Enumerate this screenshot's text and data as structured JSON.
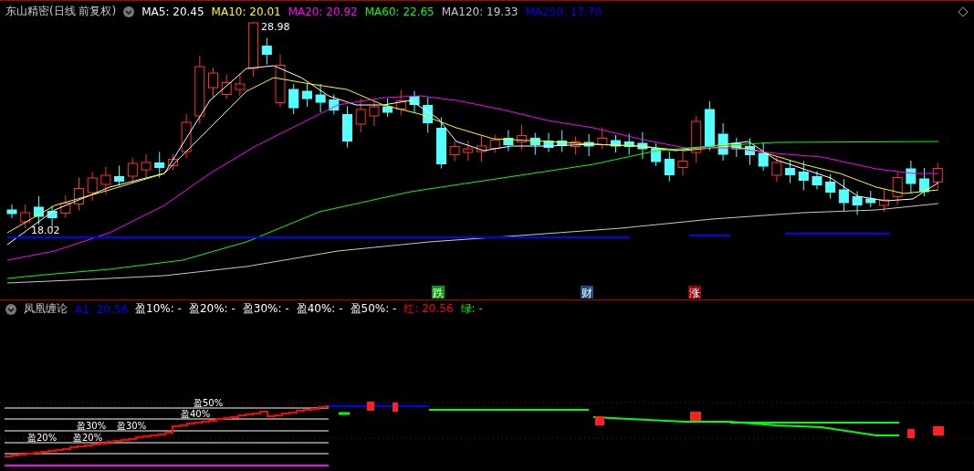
{
  "main_chart": {
    "title": "东山精密(日线 前复权)",
    "moving_averages": [
      {
        "label": "MA5:",
        "value": "20.45",
        "color": "#ffffff"
      },
      {
        "label": "MA10:",
        "value": "20.01",
        "color": "#ffff00"
      },
      {
        "label": "MA20:",
        "value": "20.92",
        "color": "#ff00ff"
      },
      {
        "label": "MA60:",
        "value": "22.65",
        "color": "#00ff00"
      },
      {
        "label": "MA120:",
        "value": "19.33",
        "color": "#c8c8c8"
      },
      {
        "label": "MA250:",
        "value": "17.70",
        "color": "#0000ff"
      }
    ],
    "price_labels": [
      "28.98",
      "18.02"
    ],
    "event_markers": [
      {
        "label": "跌",
        "color": "#00a000"
      },
      {
        "label": "财",
        "color": "#1a4b8a"
      },
      {
        "label": "涨",
        "color": "#a00000"
      }
    ]
  },
  "indicator": {
    "title": "凤凰缠论",
    "values": [
      {
        "label": "A1:",
        "value": "20.56",
        "color": "#0000ff"
      },
      {
        "label": "盈10%:",
        "value": "-",
        "color": "#ffffff"
      },
      {
        "label": "盈20%:",
        "value": "-",
        "color": "#ffffff"
      },
      {
        "label": "盈30%:",
        "value": "-",
        "color": "#ffffff"
      },
      {
        "label": "盈40%:",
        "value": "-",
        "color": "#ffffff"
      },
      {
        "label": "盈50%:",
        "value": "-",
        "color": "#ffffff"
      },
      {
        "label": "红:",
        "value": "20.56",
        "color": "#ff0000"
      },
      {
        "label": "绿:",
        "value": "-",
        "color": "#00ff00"
      }
    ],
    "level_labels": [
      "盈50%",
      "盈40%",
      "盈30%",
      "盈30%",
      "盈20%",
      "盈20%"
    ]
  }
}
